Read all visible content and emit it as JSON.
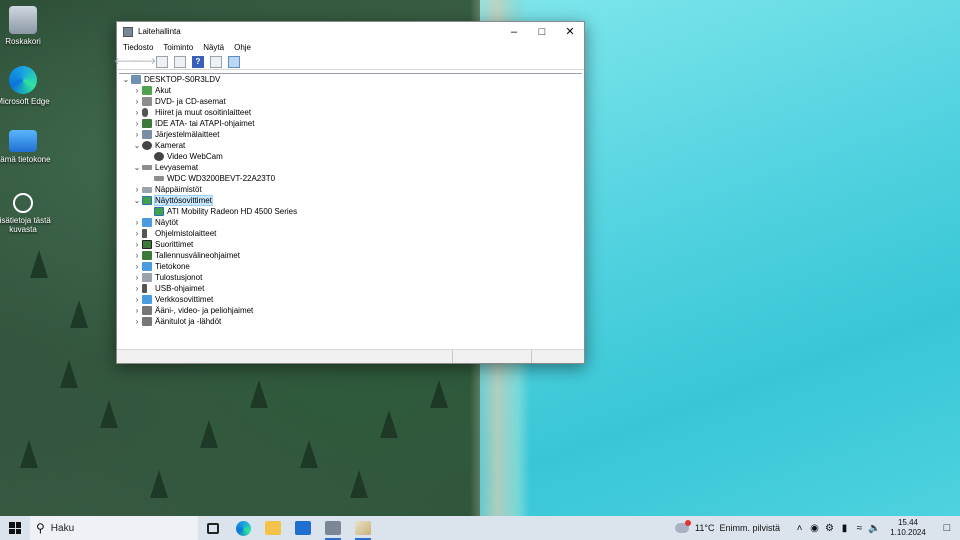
{
  "desktop": {
    "icons": [
      {
        "label": "Roskakori",
        "icon": "recycle-bin-icon"
      },
      {
        "label": "Microsoft Edge",
        "icon": "edge-icon"
      },
      {
        "label": "Tämä tietokone",
        "icon": "this-pc-icon"
      },
      {
        "label": "Lisätietoja tästä kuvasta",
        "icon": "learn-about-picture-icon"
      }
    ]
  },
  "window": {
    "title": "Laitehallinta",
    "menu": [
      "Tiedosto",
      "Toiminto",
      "Näytä",
      "Ohje"
    ],
    "toolbar": [
      "back-arrow-icon",
      "forward-arrow-icon",
      "show-hide-console-tree-icon",
      "properties-icon",
      "help-icon",
      "view-icon",
      "scan-hardware-icon"
    ],
    "tree": {
      "root": "DESKTOP-S0R3LDV",
      "nodes": [
        {
          "label": "Akut",
          "expanded": false,
          "icon": "battery-icon"
        },
        {
          "label": "DVD- ja CD-asemat",
          "expanded": false,
          "icon": "dvd-drive-icon"
        },
        {
          "label": "Hiiret ja muut osoitinlaitteet",
          "expanded": false,
          "icon": "mouse-icon"
        },
        {
          "label": "IDE ATA- tai ATAPI-ohjaimet",
          "expanded": false,
          "icon": "ide-controller-icon"
        },
        {
          "label": "Järjestelmälaitteet",
          "expanded": false,
          "icon": "system-devices-icon"
        },
        {
          "label": "Kamerat",
          "expanded": true,
          "icon": "camera-icon"
        },
        {
          "label": "Video WebCam",
          "child": true,
          "icon": "webcam-icon"
        },
        {
          "label": "Levyasemat",
          "expanded": true,
          "icon": "disk-drive-icon"
        },
        {
          "label": "WDC WD3200BEVT-22A23T0",
          "child": true,
          "icon": "hard-disk-icon"
        },
        {
          "label": "Näppäimistöt",
          "expanded": false,
          "icon": "keyboard-icon"
        },
        {
          "label": "Näyttösovittimet",
          "expanded": true,
          "icon": "display-adapter-icon",
          "selected": true
        },
        {
          "label": "ATI Mobility Radeon HD 4500 Series",
          "child": true,
          "icon": "gpu-icon"
        },
        {
          "label": "Näytöt",
          "expanded": false,
          "icon": "monitor-icon"
        },
        {
          "label": "Ohjelmistolaitteet",
          "expanded": false,
          "icon": "software-device-icon"
        },
        {
          "label": "Suorittimet",
          "expanded": false,
          "icon": "processor-icon"
        },
        {
          "label": "Tallennusvälineohjaimet",
          "expanded": false,
          "icon": "storage-controller-icon"
        },
        {
          "label": "Tietokone",
          "expanded": false,
          "icon": "computer-icon"
        },
        {
          "label": "Tulostusjonot",
          "expanded": false,
          "icon": "printer-icon"
        },
        {
          "label": "USB-ohjaimet",
          "expanded": false,
          "icon": "usb-icon"
        },
        {
          "label": "Verkkosovittimet",
          "expanded": false,
          "icon": "network-adapter-icon"
        },
        {
          "label": "Ääni-, video- ja peliohjaimet",
          "expanded": false,
          "icon": "sound-icon"
        },
        {
          "label": "Äänitulot ja -lähdöt",
          "expanded": false,
          "icon": "audio-io-icon"
        }
      ]
    }
  },
  "taskbar": {
    "search_placeholder": "Haku",
    "weather_temp": "11°C",
    "weather_text": "Enimm. pilvistä",
    "time": "15.44",
    "date": "1.10.2024"
  },
  "colors": {
    "selection": "#cce8ff",
    "taskbar_bg": "#dbe3ec",
    "accent": "#2b6cd2"
  }
}
